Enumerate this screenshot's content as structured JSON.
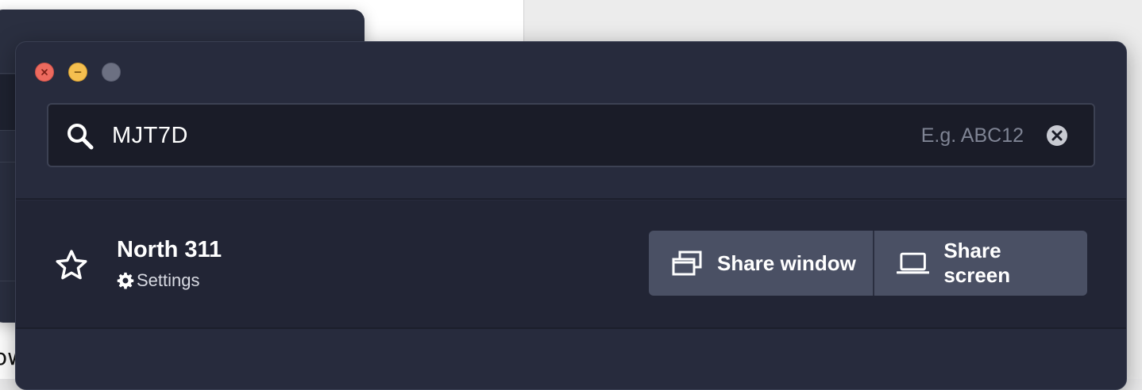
{
  "search": {
    "value": "MJT7D",
    "placeholder": "E.g. ABC12"
  },
  "icons": {
    "search": "search-icon",
    "clear": "clear-icon",
    "star": "star-icon",
    "settings": "gear-icon",
    "share_window": "windows-icon",
    "share_screen": "laptop-icon"
  },
  "result": {
    "title": "North 311",
    "settings_label": "Settings",
    "share_window_label": "Share window",
    "share_screen_label": "Share screen"
  },
  "background_text": "ow",
  "colors": {
    "window_bg": "#272b3d",
    "row_bg": "#222535",
    "button_bg": "#4a5064",
    "close": "#ed6a5e",
    "minimize": "#f5bf4f",
    "maximize": "#6c7082"
  }
}
